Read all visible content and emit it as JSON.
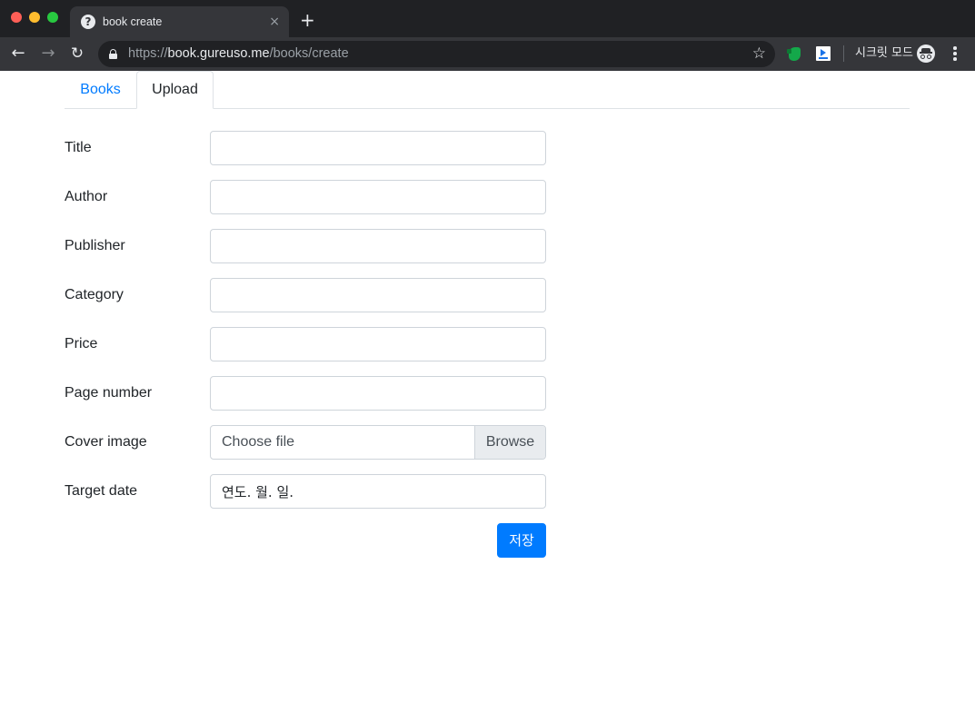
{
  "browser": {
    "tab_title": "book create",
    "tab_favicon": "?",
    "tab_close_icon": "×",
    "new_tab_icon": "+",
    "url_scheme": "https://",
    "url_host": "book.gureuso.me",
    "url_path": "/books/create",
    "incognito_label": "시크릿 모드",
    "back_icon": "←",
    "forward_icon": "→",
    "reload_icon": "↻",
    "bookmark_icon": "☆"
  },
  "nav": {
    "tabs": [
      {
        "label": "Books",
        "active": false
      },
      {
        "label": "Upload",
        "active": true
      }
    ]
  },
  "form": {
    "title_label": "Title",
    "author_label": "Author",
    "publisher_label": "Publisher",
    "category_label": "Category",
    "price_label": "Price",
    "page_number_label": "Page number",
    "cover_image_label": "Cover image",
    "cover_image_placeholder": "Choose file",
    "browse_label": "Browse",
    "target_date_label": "Target date",
    "target_date_placeholder": "연도. 월. 일.",
    "title_value": "",
    "author_value": "",
    "publisher_value": "",
    "category_value": "",
    "price_value": "",
    "page_number_value": "",
    "save_label": "저장"
  },
  "colors": {
    "primary": "#007bff",
    "chrome_dark": "#202124",
    "chrome_toolbar": "#35363a"
  }
}
